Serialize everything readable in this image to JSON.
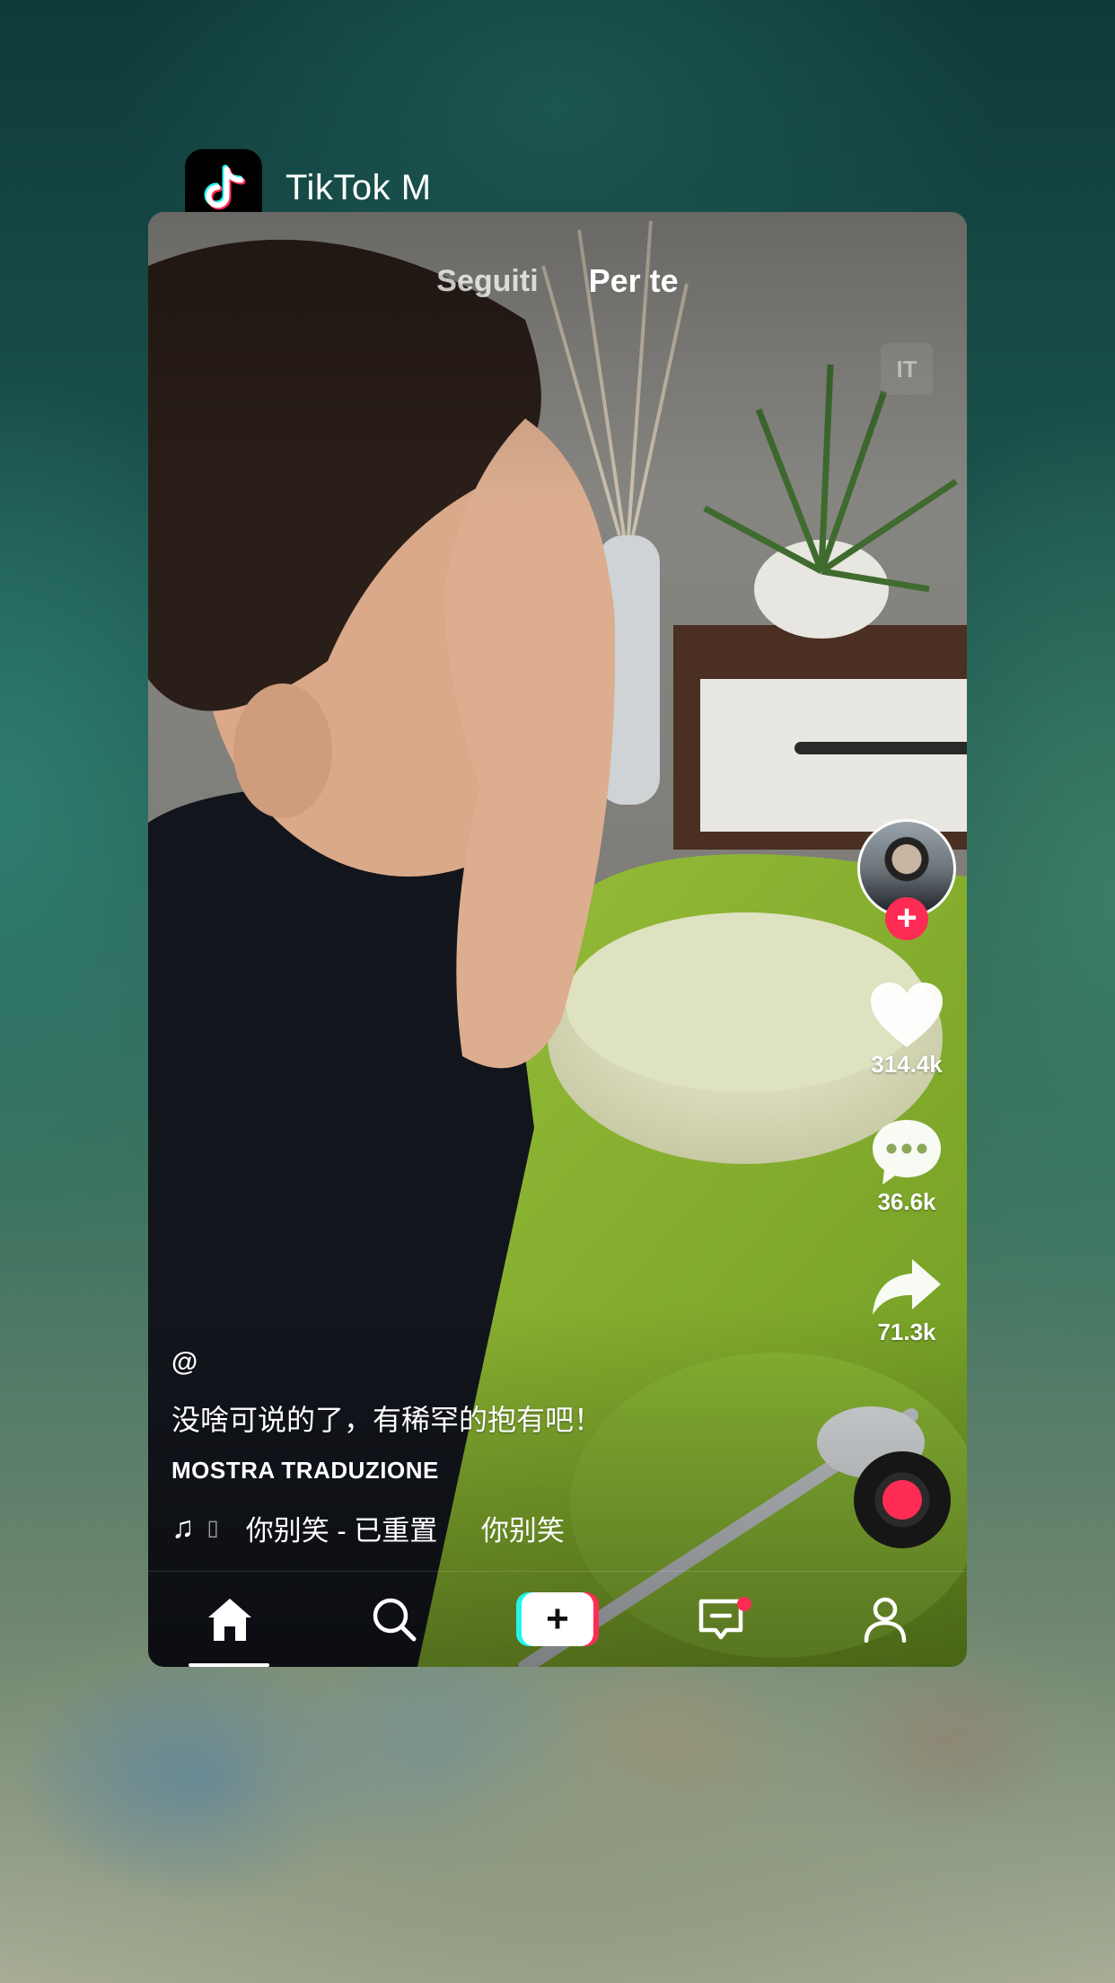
{
  "app_switcher": {
    "app_name": "TikTok M"
  },
  "feed": {
    "tabs": [
      {
        "label": "Seguiti",
        "active": false
      },
      {
        "label": "Per te",
        "active": true
      }
    ],
    "language_badge": "IT",
    "actions": {
      "likes": "314.4k",
      "comments": "36.6k",
      "shares": "71.3k"
    },
    "post": {
      "handle": "@",
      "caption": "没啥可说的了，有稀罕的抱有吧！",
      "translate_label": "MOSTRA TRADUZIONE",
      "music": "你别笑 - 已重置",
      "music_repeat": "你别笑"
    }
  },
  "bottom_nav": {
    "items": [
      "home",
      "discover",
      "create",
      "inbox",
      "profile"
    ],
    "active": "home"
  },
  "colors": {
    "accent_red": "#fe2c55",
    "accent_cyan": "#25f4ee"
  }
}
